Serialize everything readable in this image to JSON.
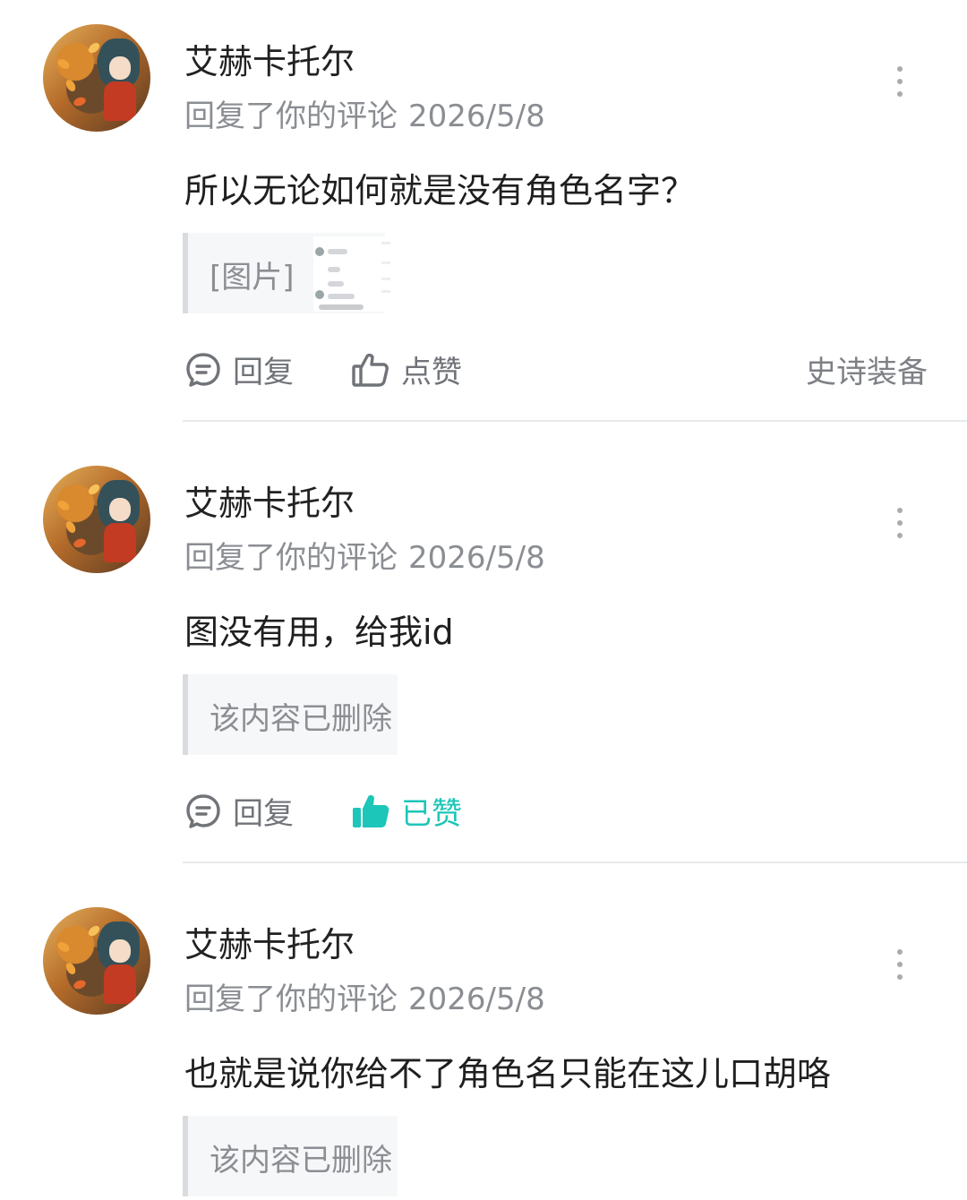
{
  "comments": [
    {
      "author": "艾赫卡托尔",
      "action": "回复了你的评论",
      "date": "2026/5/8",
      "text": "所以无论如何就是没有角色名字？",
      "quote": "[图片]",
      "reply_label": "回复",
      "like_label": "点赞",
      "liked": false,
      "badge": "史诗装备"
    },
    {
      "author": "艾赫卡托尔",
      "action": "回复了你的评论",
      "date": "2026/5/8",
      "text": "图没有用，给我id",
      "quote": "该内容已删除",
      "reply_label": "回复",
      "like_label": "已赞",
      "liked": true
    },
    {
      "author": "艾赫卡托尔",
      "action": "回复了你的评论",
      "date": "2026/5/8",
      "text": "也就是说你给不了角色名只能在这儿口胡咯",
      "quote": "该内容已删除"
    }
  ],
  "colors": {
    "accent": "#1cc6b8",
    "meta": "#8a8d92",
    "divider": "#e8e9eb"
  },
  "icons": [
    "comment-bubble-icon",
    "thumbs-up-outline-icon",
    "thumbs-up-filled-icon",
    "more-vertical-icon"
  ]
}
